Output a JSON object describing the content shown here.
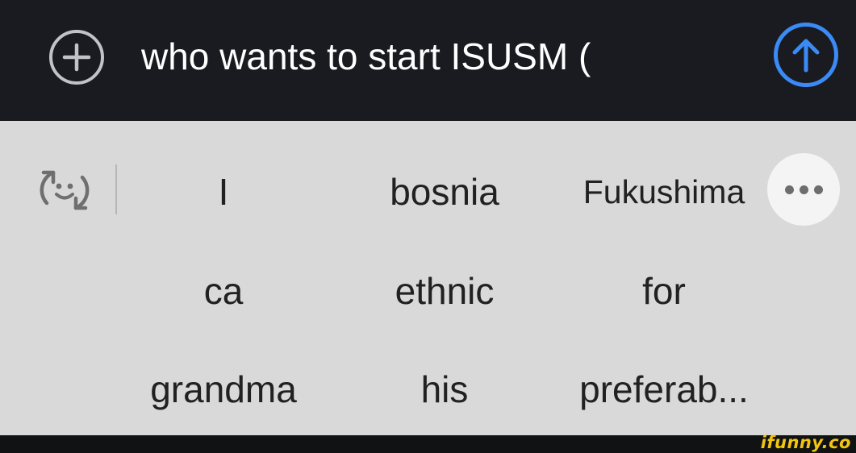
{
  "compose": {
    "text": "who wants to start ISUSM (",
    "add_icon": "plus-circle-icon",
    "send_icon": "arrow-up-circle-icon",
    "send_color": "#3b8bf7"
  },
  "suggestions": {
    "emoji_icon": "emoji-swap-icon",
    "more_icon": "more-horizontal-icon",
    "rows": [
      [
        "I",
        "bosnia",
        "Fukushima"
      ],
      [
        "ca",
        "ethnic",
        "for"
      ],
      [
        "grandma",
        "his",
        "preferab..."
      ]
    ]
  },
  "watermark": {
    "text": "ifunny.co",
    "color": "#f1c40f"
  }
}
